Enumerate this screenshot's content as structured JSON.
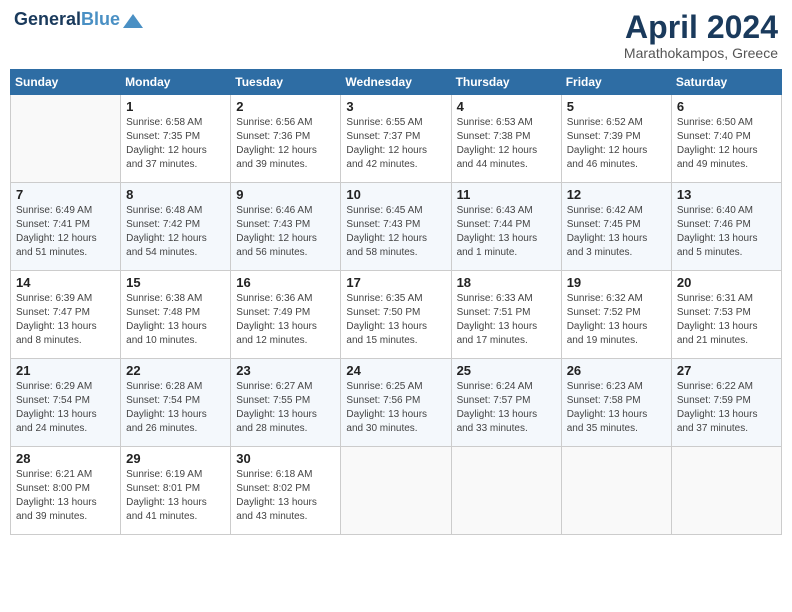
{
  "header": {
    "logo_line1": "General",
    "logo_line2": "Blue",
    "month_title": "April 2024",
    "location": "Marathokampos, Greece"
  },
  "weekdays": [
    "Sunday",
    "Monday",
    "Tuesday",
    "Wednesday",
    "Thursday",
    "Friday",
    "Saturday"
  ],
  "weeks": [
    [
      {
        "day": "",
        "empty": true
      },
      {
        "day": "1",
        "sunrise": "Sunrise: 6:58 AM",
        "sunset": "Sunset: 7:35 PM",
        "daylight": "Daylight: 12 hours and 37 minutes."
      },
      {
        "day": "2",
        "sunrise": "Sunrise: 6:56 AM",
        "sunset": "Sunset: 7:36 PM",
        "daylight": "Daylight: 12 hours and 39 minutes."
      },
      {
        "day": "3",
        "sunrise": "Sunrise: 6:55 AM",
        "sunset": "Sunset: 7:37 PM",
        "daylight": "Daylight: 12 hours and 42 minutes."
      },
      {
        "day": "4",
        "sunrise": "Sunrise: 6:53 AM",
        "sunset": "Sunset: 7:38 PM",
        "daylight": "Daylight: 12 hours and 44 minutes."
      },
      {
        "day": "5",
        "sunrise": "Sunrise: 6:52 AM",
        "sunset": "Sunset: 7:39 PM",
        "daylight": "Daylight: 12 hours and 46 minutes."
      },
      {
        "day": "6",
        "sunrise": "Sunrise: 6:50 AM",
        "sunset": "Sunset: 7:40 PM",
        "daylight": "Daylight: 12 hours and 49 minutes."
      }
    ],
    [
      {
        "day": "7",
        "sunrise": "Sunrise: 6:49 AM",
        "sunset": "Sunset: 7:41 PM",
        "daylight": "Daylight: 12 hours and 51 minutes."
      },
      {
        "day": "8",
        "sunrise": "Sunrise: 6:48 AM",
        "sunset": "Sunset: 7:42 PM",
        "daylight": "Daylight: 12 hours and 54 minutes."
      },
      {
        "day": "9",
        "sunrise": "Sunrise: 6:46 AM",
        "sunset": "Sunset: 7:43 PM",
        "daylight": "Daylight: 12 hours and 56 minutes."
      },
      {
        "day": "10",
        "sunrise": "Sunrise: 6:45 AM",
        "sunset": "Sunset: 7:43 PM",
        "daylight": "Daylight: 12 hours and 58 minutes."
      },
      {
        "day": "11",
        "sunrise": "Sunrise: 6:43 AM",
        "sunset": "Sunset: 7:44 PM",
        "daylight": "Daylight: 13 hours and 1 minute."
      },
      {
        "day": "12",
        "sunrise": "Sunrise: 6:42 AM",
        "sunset": "Sunset: 7:45 PM",
        "daylight": "Daylight: 13 hours and 3 minutes."
      },
      {
        "day": "13",
        "sunrise": "Sunrise: 6:40 AM",
        "sunset": "Sunset: 7:46 PM",
        "daylight": "Daylight: 13 hours and 5 minutes."
      }
    ],
    [
      {
        "day": "14",
        "sunrise": "Sunrise: 6:39 AM",
        "sunset": "Sunset: 7:47 PM",
        "daylight": "Daylight: 13 hours and 8 minutes."
      },
      {
        "day": "15",
        "sunrise": "Sunrise: 6:38 AM",
        "sunset": "Sunset: 7:48 PM",
        "daylight": "Daylight: 13 hours and 10 minutes."
      },
      {
        "day": "16",
        "sunrise": "Sunrise: 6:36 AM",
        "sunset": "Sunset: 7:49 PM",
        "daylight": "Daylight: 13 hours and 12 minutes."
      },
      {
        "day": "17",
        "sunrise": "Sunrise: 6:35 AM",
        "sunset": "Sunset: 7:50 PM",
        "daylight": "Daylight: 13 hours and 15 minutes."
      },
      {
        "day": "18",
        "sunrise": "Sunrise: 6:33 AM",
        "sunset": "Sunset: 7:51 PM",
        "daylight": "Daylight: 13 hours and 17 minutes."
      },
      {
        "day": "19",
        "sunrise": "Sunrise: 6:32 AM",
        "sunset": "Sunset: 7:52 PM",
        "daylight": "Daylight: 13 hours and 19 minutes."
      },
      {
        "day": "20",
        "sunrise": "Sunrise: 6:31 AM",
        "sunset": "Sunset: 7:53 PM",
        "daylight": "Daylight: 13 hours and 21 minutes."
      }
    ],
    [
      {
        "day": "21",
        "sunrise": "Sunrise: 6:29 AM",
        "sunset": "Sunset: 7:54 PM",
        "daylight": "Daylight: 13 hours and 24 minutes."
      },
      {
        "day": "22",
        "sunrise": "Sunrise: 6:28 AM",
        "sunset": "Sunset: 7:54 PM",
        "daylight": "Daylight: 13 hours and 26 minutes."
      },
      {
        "day": "23",
        "sunrise": "Sunrise: 6:27 AM",
        "sunset": "Sunset: 7:55 PM",
        "daylight": "Daylight: 13 hours and 28 minutes."
      },
      {
        "day": "24",
        "sunrise": "Sunrise: 6:25 AM",
        "sunset": "Sunset: 7:56 PM",
        "daylight": "Daylight: 13 hours and 30 minutes."
      },
      {
        "day": "25",
        "sunrise": "Sunrise: 6:24 AM",
        "sunset": "Sunset: 7:57 PM",
        "daylight": "Daylight: 13 hours and 33 minutes."
      },
      {
        "day": "26",
        "sunrise": "Sunrise: 6:23 AM",
        "sunset": "Sunset: 7:58 PM",
        "daylight": "Daylight: 13 hours and 35 minutes."
      },
      {
        "day": "27",
        "sunrise": "Sunrise: 6:22 AM",
        "sunset": "Sunset: 7:59 PM",
        "daylight": "Daylight: 13 hours and 37 minutes."
      }
    ],
    [
      {
        "day": "28",
        "sunrise": "Sunrise: 6:21 AM",
        "sunset": "Sunset: 8:00 PM",
        "daylight": "Daylight: 13 hours and 39 minutes."
      },
      {
        "day": "29",
        "sunrise": "Sunrise: 6:19 AM",
        "sunset": "Sunset: 8:01 PM",
        "daylight": "Daylight: 13 hours and 41 minutes."
      },
      {
        "day": "30",
        "sunrise": "Sunrise: 6:18 AM",
        "sunset": "Sunset: 8:02 PM",
        "daylight": "Daylight: 13 hours and 43 minutes."
      },
      {
        "day": "",
        "empty": true
      },
      {
        "day": "",
        "empty": true
      },
      {
        "day": "",
        "empty": true
      },
      {
        "day": "",
        "empty": true
      }
    ]
  ]
}
